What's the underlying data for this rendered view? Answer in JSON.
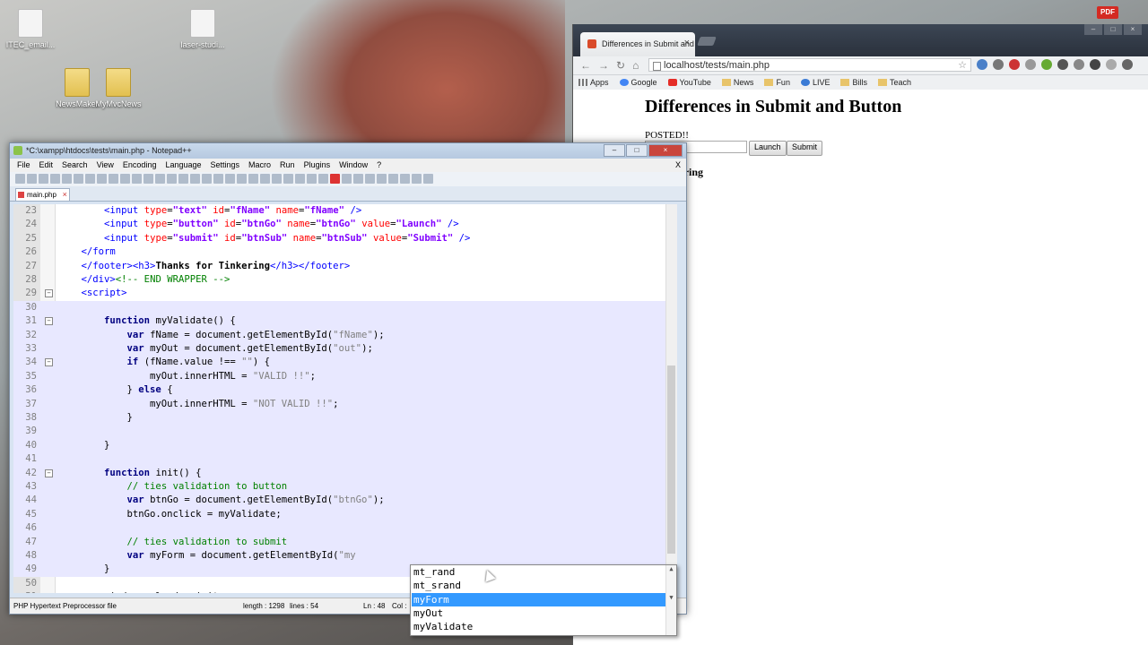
{
  "desktop": {
    "icons": [
      {
        "label": "ITEC_email...",
        "kind": "doc"
      },
      {
        "label": "laser-studi...",
        "kind": "doc"
      },
      {
        "label": "NewsMaker",
        "kind": "folder"
      },
      {
        "label": "MyMvcNews",
        "kind": "folder"
      }
    ]
  },
  "browser": {
    "tab_title": "Differences in Submit and",
    "tab_close": "×",
    "url": "localhost/tests/main.php",
    "bookmarks": [
      {
        "label": "Apps",
        "icon": "apps-grid-icon"
      },
      {
        "label": "Google",
        "icon": "google-icon"
      },
      {
        "label": "YouTube",
        "icon": "youtube-icon"
      },
      {
        "label": "News",
        "icon": "folder-icon"
      },
      {
        "label": "Fun",
        "icon": "folder-icon"
      },
      {
        "label": "LIVE",
        "icon": "live-icon"
      },
      {
        "label": "Bills",
        "icon": "folder-icon"
      },
      {
        "label": "Teach",
        "icon": "folder-icon"
      }
    ],
    "page": {
      "heading": "Differences in Submit and Button",
      "posted": "POSTED!!",
      "launch_button": "Launch",
      "submit_button": "Submit",
      "footer_text": "or Tinkering"
    },
    "pdf_badge": "PDF"
  },
  "notepad": {
    "title": "*C:\\xampp\\htdocs\\tests\\main.php - Notepad++",
    "menu": [
      "File",
      "Edit",
      "Search",
      "View",
      "Encoding",
      "Language",
      "Settings",
      "Macro",
      "Run",
      "Plugins",
      "Window",
      "?"
    ],
    "menu_close": "X",
    "tab_label": "main.php",
    "lines": [
      {
        "n": "23",
        "fold": "",
        "html": "        <span class='tag'>&lt;input</span> <span class='attr'>type</span>=<span class='val'>\"text\"</span> <span class='attr'>id</span>=<span class='val'>\"fName\"</span> <span class='attr'>name</span>=<span class='val'>\"fName\"</span> <span class='tag'>/&gt;</span>"
      },
      {
        "n": "24",
        "fold": "",
        "html": "        <span class='tag'>&lt;input</span> <span class='attr'>type</span>=<span class='val'>\"button\"</span> <span class='attr'>id</span>=<span class='val'>\"btnGo\"</span> <span class='attr'>name</span>=<span class='val'>\"btnGo\"</span> <span class='attr'>value</span>=<span class='val'>\"Launch\"</span> <span class='tag'>/&gt;</span>"
      },
      {
        "n": "25",
        "fold": "",
        "html": "        <span class='tag'>&lt;input</span> <span class='attr'>type</span>=<span class='val'>\"submit\"</span> <span class='attr'>id</span>=<span class='val'>\"btnSub\"</span> <span class='attr'>name</span>=<span class='val'>\"btnSub\"</span> <span class='attr'>value</span>=<span class='val'>\"Submit\"</span> <span class='tag'>/&gt;</span>"
      },
      {
        "n": "26",
        "fold": "",
        "html": "    <span class='tag'>&lt;/form</span>"
      },
      {
        "n": "27",
        "fold": "",
        "html": "    <span class='tag'>&lt;/footer&gt;&lt;h3&gt;</span><span class='bold'>Thanks for Tinkering</span><span class='tag'>&lt;/h3&gt;&lt;/footer&gt;</span>"
      },
      {
        "n": "28",
        "fold": "",
        "html": "    <span class='tag'>&lt;/div&gt;</span><span class='cmt'>&lt;!-- END WRAPPER --&gt;</span>"
      },
      {
        "n": "29",
        "fold": "-",
        "html": "    <span class='tag'>&lt;script&gt;</span>"
      },
      {
        "n": "30",
        "fold": "",
        "html": ""
      },
      {
        "n": "31",
        "fold": "-",
        "html": "        <span class='kw'>function</span> myValidate() {"
      },
      {
        "n": "32",
        "fold": "",
        "html": "            <span class='kw'>var</span> fName = document.getElementById(<span class='str'>\"fName\"</span>);"
      },
      {
        "n": "33",
        "fold": "",
        "html": "            <span class='kw'>var</span> myOut = document.getElementById(<span class='str'>\"out\"</span>);"
      },
      {
        "n": "34",
        "fold": "-",
        "html": "            <span class='kw'>if</span> (fName.value !== <span class='str'>\"\"</span>) {"
      },
      {
        "n": "35",
        "fold": "",
        "html": "                myOut.innerHTML = <span class='str'>\"VALID !!\"</span>;"
      },
      {
        "n": "36",
        "fold": "",
        "html": "            } <span class='kw'>else</span> {"
      },
      {
        "n": "37",
        "fold": "",
        "html": "                myOut.innerHTML = <span class='str'>\"NOT VALID !!\"</span>;"
      },
      {
        "n": "38",
        "fold": "",
        "html": "            }"
      },
      {
        "n": "39",
        "fold": "",
        "html": ""
      },
      {
        "n": "40",
        "fold": "",
        "html": "        }"
      },
      {
        "n": "41",
        "fold": "",
        "html": ""
      },
      {
        "n": "42",
        "fold": "-",
        "html": "        <span class='kw'>function</span> init() {"
      },
      {
        "n": "43",
        "fold": "",
        "html": "            <span class='cmt'>// ties validation to button</span>"
      },
      {
        "n": "44",
        "fold": "",
        "html": "            <span class='kw'>var</span> btnGo = document.getElementById(<span class='str'>\"btnGo\"</span>);"
      },
      {
        "n": "45",
        "fold": "",
        "html": "            btnGo.onclick = myValidate;"
      },
      {
        "n": "46",
        "fold": "",
        "html": ""
      },
      {
        "n": "47",
        "fold": "",
        "html": "            <span class='cmt'>// ties validation to submit</span>"
      },
      {
        "n": "48",
        "fold": "",
        "html": "            <span class='kw'>var</span> myForm = document.getElementById(<span class='str'>\"my</span>"
      },
      {
        "n": "49",
        "fold": "",
        "html": "        }"
      },
      {
        "n": "50",
        "fold": "",
        "html": ""
      },
      {
        "n": "51",
        "fold": "",
        "html": "        window.onload = init;"
      }
    ],
    "status": {
      "filetype": "PHP Hypertext Preprocessor file",
      "length": "length : 1298",
      "lines": "lines : 54",
      "ln": "Ln : 48",
      "col": "Col :"
    }
  },
  "autocomplete": {
    "items": [
      "mt_rand",
      "mt_srand",
      "myForm",
      "myOut",
      "myValidate"
    ],
    "selected_index": 2
  }
}
